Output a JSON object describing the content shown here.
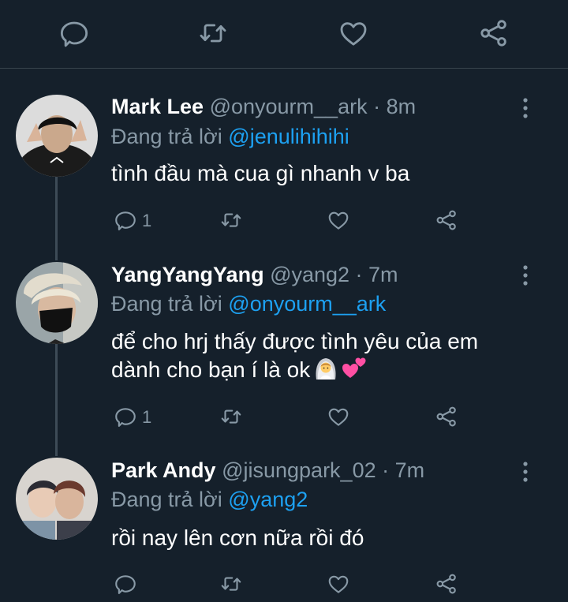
{
  "colors": {
    "background": "#15202b",
    "text": "#ffffff",
    "muted": "#8899a6",
    "link": "#1da1f2",
    "divider": "#38444d"
  },
  "top_actions": [
    "reply-icon",
    "retweet-icon",
    "like-icon",
    "share-icon"
  ],
  "tweets": [
    {
      "display_name": "Mark Lee",
      "meta": "@onyourm__ark · 8m",
      "reply_prefix": "Đang trả lời",
      "reply_to": "@jenulihihihi",
      "text": "tình đầu mà cua gì nhanh v ba",
      "reply_count": "1"
    },
    {
      "display_name": "YangYangYang",
      "meta": "@yang2 · 7m",
      "reply_prefix": "Đang trả lời",
      "reply_to": "@onyourm__ark",
      "text_line1": "để cho hrj thấy được tình yêu của em",
      "text_line2": "dành cho bạn í là ok",
      "emoji": [
        "bride-with-veil-emoji",
        "two-hearts-emoji"
      ],
      "reply_count": "1"
    },
    {
      "display_name": "Park Andy",
      "meta": "@jisungpark_02 · 7m",
      "reply_prefix": "Đang trả lời",
      "reply_to": "@yang2",
      "text": "rồi nay lên cơn nữa rồi đó",
      "reply_count": ""
    }
  ]
}
